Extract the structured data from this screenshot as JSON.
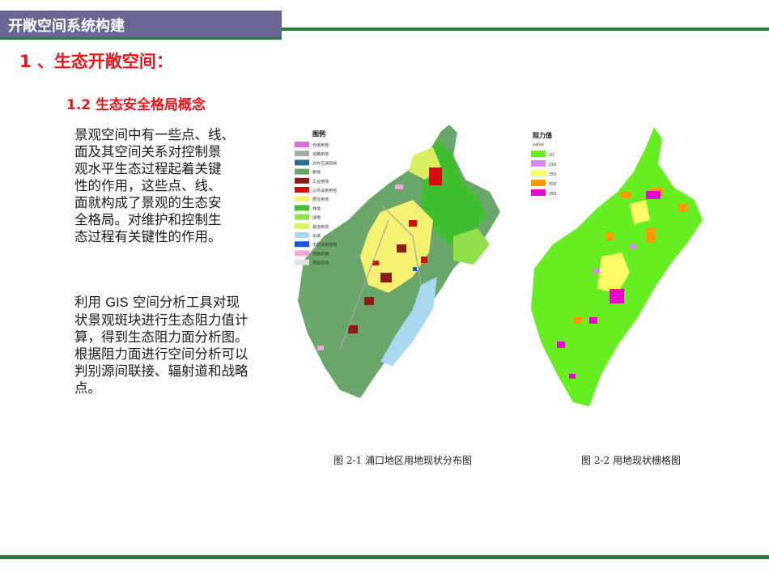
{
  "header": {
    "title": "开敞空间系统构建"
  },
  "section": {
    "heading": "1 、生态开敞空间："
  },
  "subsection": {
    "heading": "1.2  生态安全格局概念"
  },
  "body": {
    "paragraph1": [
      "景观空间中有一些点、线、",
      "面及其空间关系对控制景",
      "观水平生态过程起着关键",
      "性的作用，这些点、线、",
      "面就构成了景观的生态安",
      "全格局。对维护和控制生",
      "态过程有关键性的作用。"
    ],
    "paragraph2_prefix": "利用 ",
    "paragraph2_gis": "GIS",
    "paragraph2_line1_rest": "  空间分析工具对现",
    "paragraph2": [
      "状景观斑块进行生态阻力值计",
      "算，得到生态阻力面分析图。",
      "根据阻力面进行空间分析可以",
      "判别源间联接、辐射道和战略",
      "点。"
    ]
  },
  "figure1": {
    "caption": "图  2-1  浦口地区用地现状分布图",
    "legend_title": "图例",
    "legend": [
      {
        "label": "仓储用地",
        "color": "#d56ee0"
      },
      {
        "label": "道路用地",
        "color": "#a8a8a8"
      },
      {
        "label": "对外交通用地",
        "color": "#2f6f8f"
      },
      {
        "label": "耕地",
        "color": "#6aa56a"
      },
      {
        "label": "工业用地",
        "color": "#8b1a1a"
      },
      {
        "label": "公共设施用地",
        "color": "#d01010"
      },
      {
        "label": "居住用地",
        "color": "#f4f070"
      },
      {
        "label": "林地",
        "color": "#3fbf2f"
      },
      {
        "label": "绿地",
        "color": "#8fe04a"
      },
      {
        "label": "其他用地",
        "color": "#d8f060"
      },
      {
        "label": "水域",
        "color": "#a8d8f0"
      },
      {
        "label": "市政设施用地",
        "color": "#1a5ad8"
      },
      {
        "label": "特殊用地",
        "color": "#f0a8d8"
      },
      {
        "label": "预留用地",
        "color": "#e0e0e0"
      }
    ]
  },
  "figure2": {
    "caption": "图  2-2  用地现状栅格图",
    "legend_title": "阻力值",
    "legend_subtitle": "value",
    "legend": [
      {
        "label": "10",
        "color": "#66ee22"
      },
      {
        "label": "150",
        "color": "#dd88ff"
      },
      {
        "label": "250",
        "color": "#ffff66"
      },
      {
        "label": "300",
        "color": "#ff9900"
      },
      {
        "label": "350",
        "color": "#ee00cc"
      }
    ]
  }
}
